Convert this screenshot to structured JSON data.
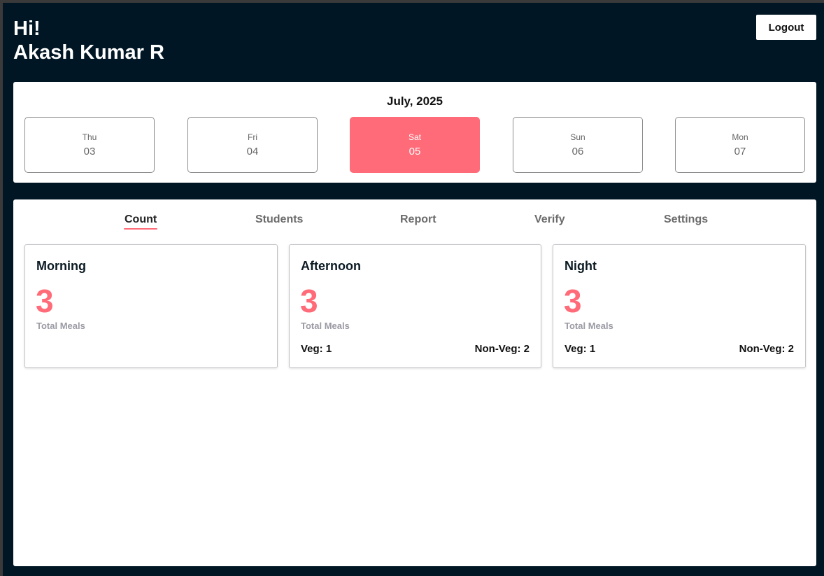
{
  "header": {
    "greeting": "Hi!",
    "user_name": "Akash Kumar R",
    "logout_label": "Logout"
  },
  "calendar": {
    "month": "July, 2025",
    "days": [
      {
        "name": "Thu",
        "num": "03",
        "selected": false
      },
      {
        "name": "Fri",
        "num": "04",
        "selected": false
      },
      {
        "name": "Sat",
        "num": "05",
        "selected": true
      },
      {
        "name": "Sun",
        "num": "06",
        "selected": false
      },
      {
        "name": "Mon",
        "num": "07",
        "selected": false
      }
    ]
  },
  "tabs": [
    {
      "label": "Count",
      "active": true
    },
    {
      "label": "Students",
      "active": false
    },
    {
      "label": "Report",
      "active": false
    },
    {
      "label": "Verify",
      "active": false
    },
    {
      "label": "Settings",
      "active": false
    }
  ],
  "cards": [
    {
      "title": "Morning",
      "count": "3",
      "sub": "Total Meals",
      "veg": "",
      "nonveg": ""
    },
    {
      "title": "Afternoon",
      "count": "3",
      "sub": "Total Meals",
      "veg": "Veg: 1",
      "nonveg": "Non-Veg: 2"
    },
    {
      "title": "Night",
      "count": "3",
      "sub": "Total Meals",
      "veg": "Veg: 1",
      "nonveg": "Non-Veg: 2"
    }
  ],
  "colors": {
    "accent": "#ff6b78",
    "header_bg": "#011624",
    "card_bg": "#ffffff"
  }
}
